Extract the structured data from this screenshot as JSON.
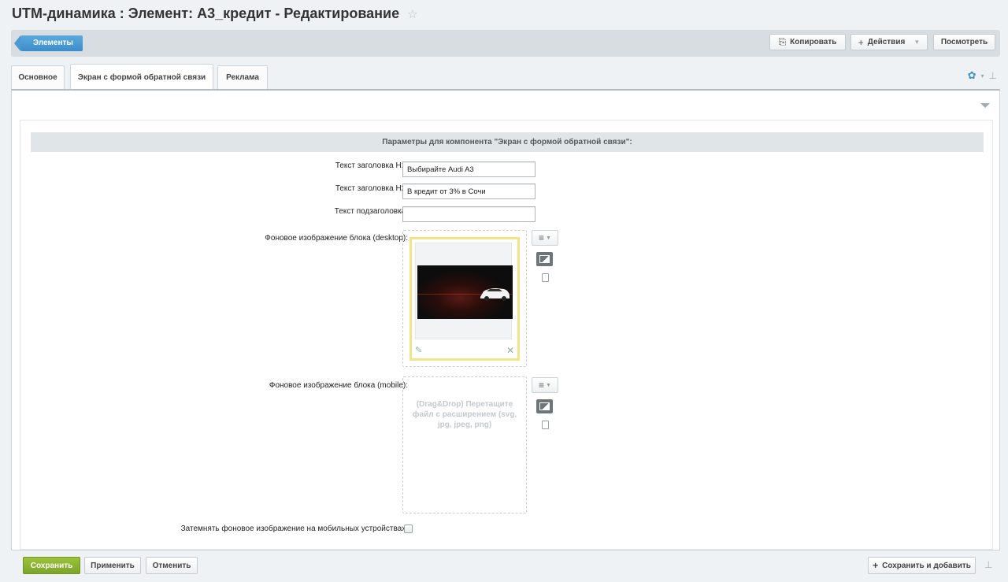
{
  "title": "UTM-динамика : Элемент: А3_кредит - Редактирование",
  "toolbar": {
    "back_label": "Элементы",
    "copy_label": "Копировать",
    "actions_label": "Действия",
    "view_label": "Посмотреть"
  },
  "tabs": [
    {
      "label": "Основное"
    },
    {
      "label": "Экран с формой обратной связи"
    },
    {
      "label": "Реклама"
    }
  ],
  "section": {
    "title": "Параметры для компонента \"Экран с формой обратной связи\":"
  },
  "fields": {
    "h1_label": "Текст заголовка H1:",
    "h1_value": "Выбирайте Audi A3",
    "h2_label": "Текст заголовка H2:",
    "h2_value": "В кредит от 3% в Сочи",
    "sub_label": "Текст подзаголовка:",
    "sub_value": "",
    "bg_desktop_label": "Фоновое изображение блока (desktop):",
    "bg_mobile_label": "Фоновое изображение блока (mobile):",
    "dropzone_text": "(Drag&Drop) Перетащите файл с расширением (svg, jpg, jpeg, png)",
    "darken_label": "Затемнять фоновое изображение на мобильных устройствах:",
    "darken_checked": false
  },
  "buttons": {
    "save": "Сохранить",
    "apply": "Применить",
    "cancel": "Отменить",
    "save_add": "Сохранить и добавить"
  },
  "colors": {
    "accent_blue": "#3c8dcc",
    "save_green": "#7ba52a",
    "file_highlight": "#f3e48a"
  }
}
